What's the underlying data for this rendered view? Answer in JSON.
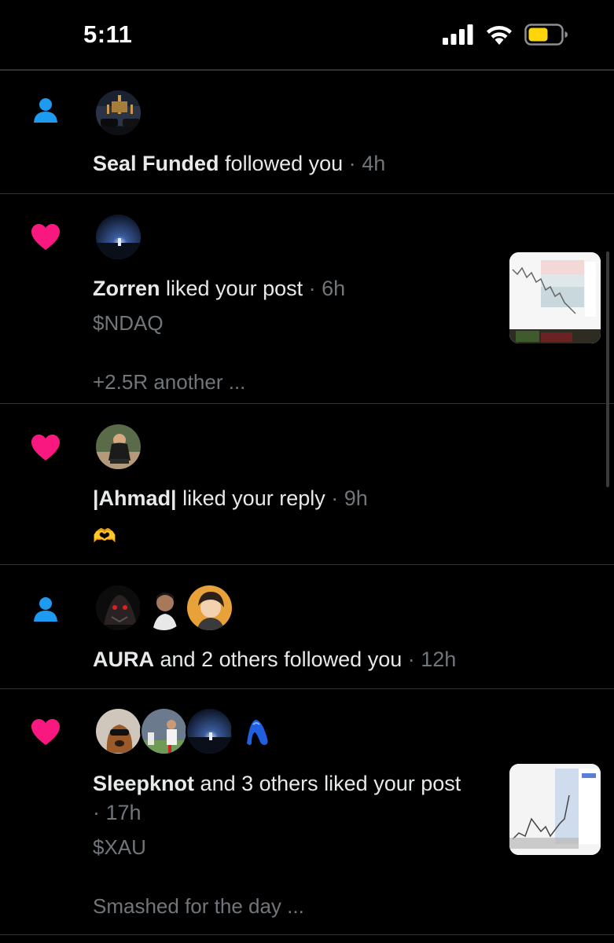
{
  "status_bar": {
    "time": "5:11"
  },
  "notifications": [
    {
      "type": "follow",
      "type_icon": "person-icon",
      "actor": "Seal Funded",
      "action": "followed you",
      "time": "4h"
    },
    {
      "type": "like",
      "type_icon": "heart-icon",
      "actor": "Zorren",
      "action": "liked your post",
      "time": "6h",
      "post_ticker": "$NDAQ",
      "post_snippet": "+2.5R another ..."
    },
    {
      "type": "like",
      "type_icon": "heart-icon",
      "actor": "|Ahmad|",
      "action": "liked your reply",
      "time": "9h",
      "reply_emoji": "🫶"
    },
    {
      "type": "follow",
      "type_icon": "person-icon",
      "actor": "AURA",
      "action": "and 2 others followed you",
      "time": "12h"
    },
    {
      "type": "like",
      "type_icon": "heart-icon",
      "actor": "Sleepknot",
      "action_line1": "and 3 others liked your",
      "action_line2": "post",
      "time": "17h",
      "post_ticker": "$XAU",
      "post_snippet": "Smashed for the day ..."
    }
  ],
  "separator": "·",
  "colors": {
    "background": "#000000",
    "follow_icon": "#1d9bf0",
    "heart_icon": "#f91880",
    "muted_text": "#71767b",
    "primary_text": "#e7e9ea",
    "divider": "#2f3336"
  }
}
